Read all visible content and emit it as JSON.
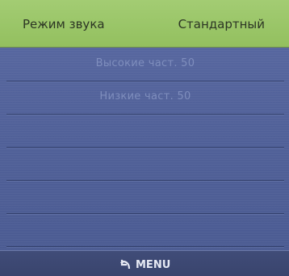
{
  "header": {
    "title": "Режим звука",
    "value": "Стандартный"
  },
  "rows": [
    {
      "label": "Высокие част. 50"
    },
    {
      "label": "Низкие част. 50"
    },
    {
      "label": ""
    },
    {
      "label": ""
    },
    {
      "label": ""
    },
    {
      "label": ""
    }
  ],
  "footer": {
    "menu_label": "MENU",
    "menu_icon": "return-arrow-icon"
  }
}
